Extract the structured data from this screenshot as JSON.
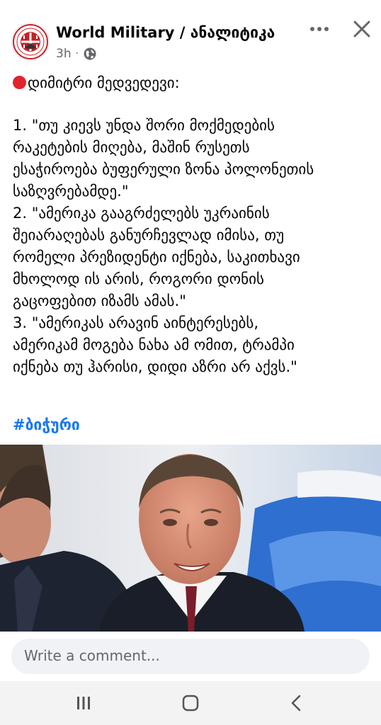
{
  "header": {
    "page_name": "World Military / ანალიტიკა",
    "time": "3h",
    "privacy_icon": "globe-icon",
    "more_icon": "more-dots-icon",
    "close_icon": "close-icon"
  },
  "post": {
    "headline": "დიმიტრი მედვედევი:",
    "lines": [
      " 1. \"თუ კიევს უნდა შორი მოქმედების",
      "რაკეტების მიღება, მაშინ რუსეთს",
      "ესაჭიროება ბუფერული ზონა პოლონეთის",
      "საზღვრებამდე.\"",
      " 2. \"ამერიკა გააგრძელებს უკრაინის",
      "შეიარაღებას განურჩევლად იმისა, თუ",
      "რომელი პრეზიდენტი იქნება, საკითხავი",
      "მხოლოდ ის არის, როგორი დონის",
      "გაცოფებით იზამს ამას.\"",
      " 3. \"ამერიკას არავინ აინტერესებს,",
      "ამერიკამ მოგება ნახა ამ ომით, ტრამპი",
      "იქნება თუ ჰარისი, დიდი აზრი არ აქვს.\""
    ],
    "hashtag": "#ბიჭური"
  },
  "comment": {
    "placeholder": "Write a comment..."
  },
  "nav": {
    "recents_icon": "recents-icon",
    "home_icon": "home-icon",
    "back_icon": "back-icon"
  },
  "colors": {
    "accent": "#1877f2",
    "red_dot": "#e0242e",
    "muted": "#65676b"
  }
}
